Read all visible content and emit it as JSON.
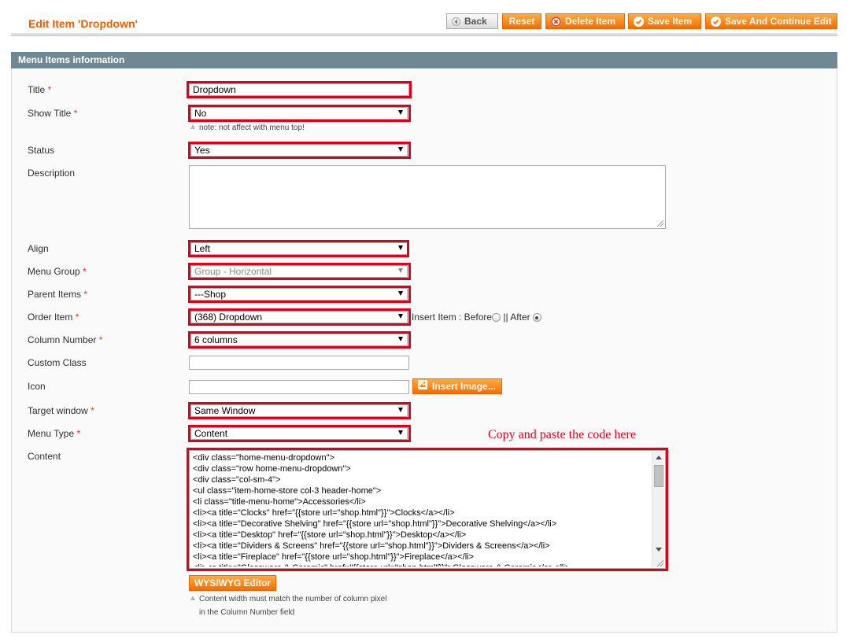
{
  "header": {
    "title": "Edit Item 'Dropdown'",
    "buttons": {
      "back": "Back",
      "reset": "Reset",
      "delete": "Delete Item",
      "save": "Save Item",
      "save_continue": "Save And Continue Edit"
    }
  },
  "section": {
    "title": "Menu Items information"
  },
  "form": {
    "title": {
      "label": "Title",
      "value": "Dropdown"
    },
    "show_title": {
      "label": "Show Title",
      "value": "No",
      "note": "note: not affect with menu top!"
    },
    "status": {
      "label": "Status",
      "value": "Yes"
    },
    "description": {
      "label": "Description",
      "value": ""
    },
    "align": {
      "label": "Align",
      "value": "Left"
    },
    "menu_group": {
      "label": "Menu Group",
      "value": "Group - Horizontal"
    },
    "parent_items": {
      "label": "Parent Items",
      "value": "---Shop"
    },
    "order_item": {
      "label": "Order Item",
      "value": "(368) Dropdown",
      "insert_label": "Insert Item : Before",
      "after_label": "|| After",
      "selected_position": "After"
    },
    "column_number": {
      "label": "Column Number",
      "value": "6 columns"
    },
    "custom_class": {
      "label": "Custom Class",
      "value": ""
    },
    "icon": {
      "label": "Icon",
      "value": "",
      "insert_button": "Insert Image..."
    },
    "target_window": {
      "label": "Target window",
      "value": "Same Window"
    },
    "menu_type": {
      "label": "Menu Type",
      "value": "Content"
    },
    "content": {
      "label": "Content",
      "lines": [
        "<div class=\"home-menu-dropdown\">",
        "<div class=\"row home-menu-dropdown\">",
        "<div class=\"col-sm-4\">",
        "<ul class=\"item-home-store col-3 header-home\">",
        "<li class=\"title-menu-home\">Accessories</li>",
        "<li><a title=\"Clocks\" href=\"{{store url=\"shop.html\"}}\">Clocks</a></li>",
        "<li><a title=\"Decorative Shelving\" href=\"{{store url=\"shop.html\"}}\">Decorative Shelving</a></li>",
        "<li><a title=\"Desktop\" href=\"{{store url=\"shop.html\"}}\">Desktop</a></li>",
        "<li><a title=\"Dividers & Screens\" href=\"{{store url=\"shop.html\"}}\">Dividers & Screens</a></li>",
        "<li><a title=\"Fireplace\" href=\"{{store url=\"shop.html\"}}\">Fireplace</a></li>",
        "<li><a title=\"Glassware & Ceramic\" href=\"{{store url=\"shop.html\"}}\">Glassware & Ceramic</a></li>"
      ],
      "wysiwyg_button": "WYSIWYG Editor",
      "note_line1": "Content width must match the number of column pixel",
      "note_line2": "in the Column Number field"
    }
  },
  "annotation": "Copy and paste the code here",
  "colors": {
    "accent": "#eb5e00",
    "highlight": "#e0001a",
    "section": "#6f8992"
  }
}
